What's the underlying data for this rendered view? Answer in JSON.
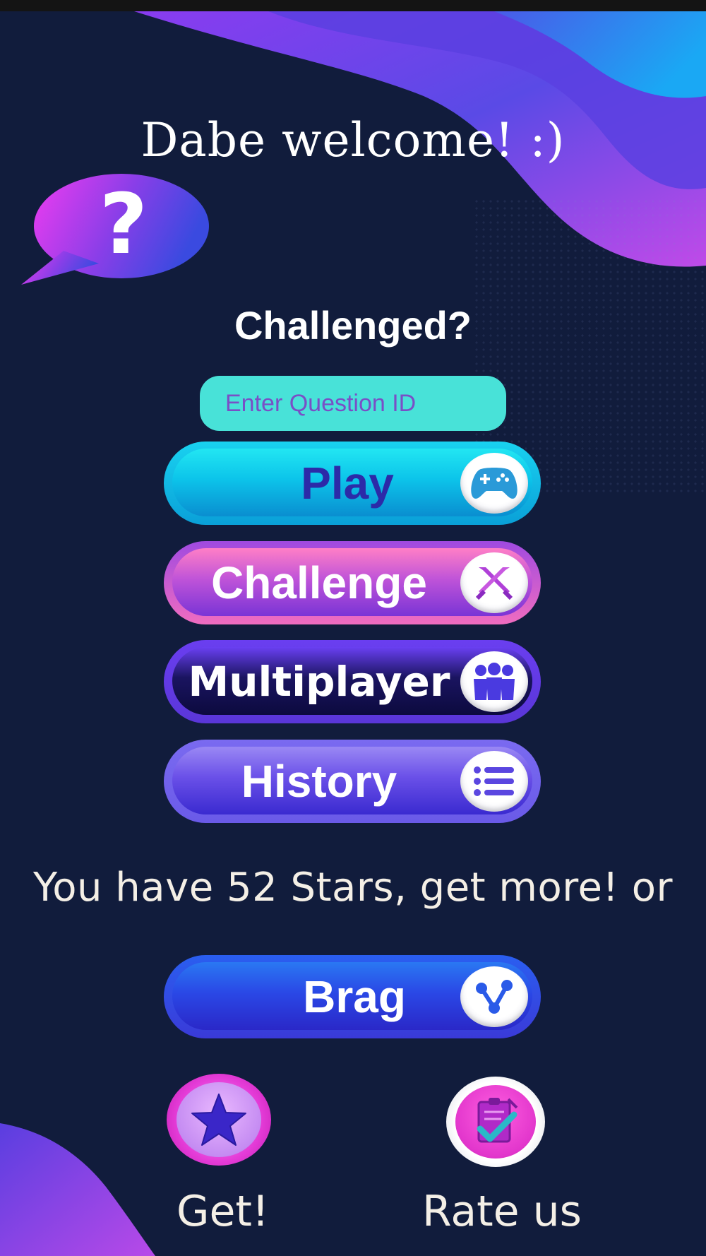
{
  "greeting": "Dabe welcome! :)",
  "bubble_symbol": "?",
  "challenged_label": "Challenged?",
  "question_input": {
    "placeholder": "Enter Question ID",
    "value": ""
  },
  "buttons": {
    "play": {
      "label": "Play",
      "icon": "gamepad-icon"
    },
    "challenge": {
      "label": "Challenge",
      "icon": "crossed-swords-icon"
    },
    "multiplayer": {
      "label": "Multiplayer",
      "icon": "group-icon"
    },
    "history": {
      "label": "History",
      "icon": "list-icon"
    },
    "brag": {
      "label": "Brag",
      "icon": "share-icon"
    }
  },
  "stars_message": "You have 52 Stars, get more! or",
  "get_button": {
    "caption": "Get!",
    "icon": "star-icon"
  },
  "rate_button": {
    "caption": "Rate us",
    "icon": "rating-checklist-icon"
  },
  "colors": {
    "background": "#111c3c",
    "accent_purple": "#8a4af0",
    "accent_cyan": "#1ad6f0",
    "accent_pink": "#ff6ec4"
  }
}
